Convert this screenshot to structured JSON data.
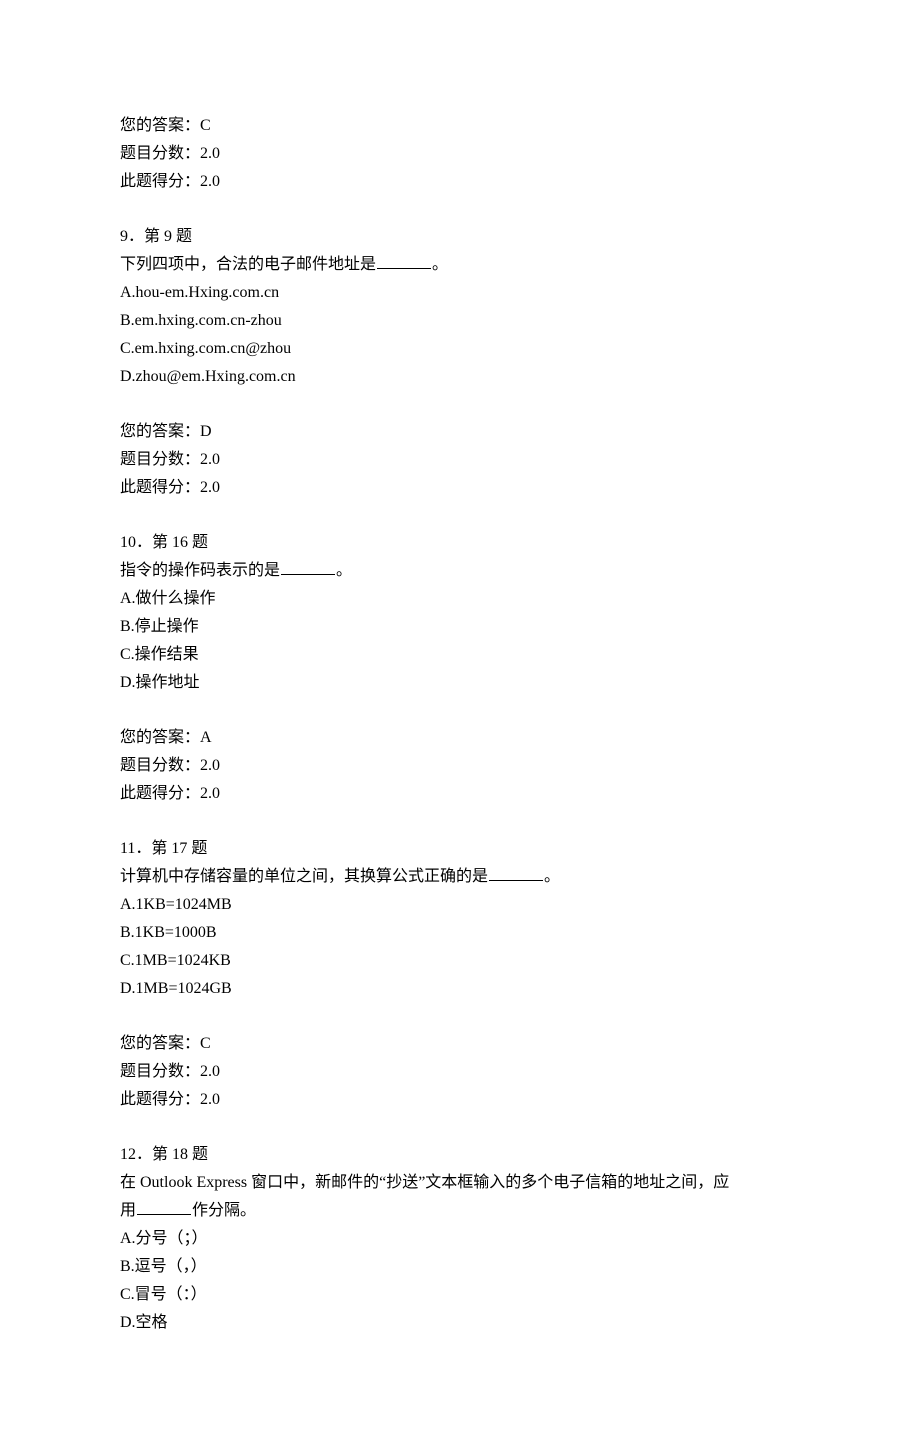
{
  "q8_result": {
    "answer_label": "您的答案：",
    "answer_value": "C",
    "full_label": "题目分数：",
    "full_value": "2.0",
    "earned_label": "此题得分：",
    "earned_value": "2.0"
  },
  "q9": {
    "number": "9．第 9 题",
    "stem_pre": "下列四项中，合法的电子邮件地址是",
    "stem_post": "。",
    "optA": "A.hou-em.Hxing.com.cn",
    "optB": "B.em.hxing.com.cn-zhou",
    "optC": "C.em.hxing.com.cn@zhou",
    "optD": "D.zhou@em.Hxing.com.cn",
    "answer_label": "您的答案：",
    "answer_value": "D",
    "full_label": "题目分数：",
    "full_value": "2.0",
    "earned_label": "此题得分：",
    "earned_value": "2.0"
  },
  "q10": {
    "number": "10．第 16 题",
    "stem_pre": "指令的操作码表示的是",
    "stem_post": "。",
    "optA": "A.做什么操作",
    "optB": "B.停止操作",
    "optC": "C.操作结果",
    "optD": "D.操作地址",
    "answer_label": "您的答案：",
    "answer_value": "A",
    "full_label": "题目分数：",
    "full_value": "2.0",
    "earned_label": "此题得分：",
    "earned_value": "2.0"
  },
  "q11": {
    "number": "11．第 17 题",
    "stem_pre": "计算机中存储容量的单位之间，其换算公式正确的是",
    "stem_post": "。",
    "optA": "A.1KB=1024MB",
    "optB": "B.1KB=1000B",
    "optC": "C.1MB=1024KB",
    "optD": "D.1MB=1024GB",
    "answer_label": "您的答案：",
    "answer_value": "C",
    "full_label": "题目分数：",
    "full_value": "2.0",
    "earned_label": "此题得分：",
    "earned_value": "2.0"
  },
  "q12": {
    "number": "12．第 18 题",
    "stem_line1_pre": "在 Outlook Express 窗口中，新邮件的“抄送”文本框输入的多个电子信箱的地址之间，应",
    "stem_line2_pre": "用",
    "stem_line2_post": "作分隔。",
    "optA": "A.分号（；）",
    "optB": "B.逗号（，）",
    "optC": "C.冒号（：）",
    "optD": "D.空格"
  }
}
